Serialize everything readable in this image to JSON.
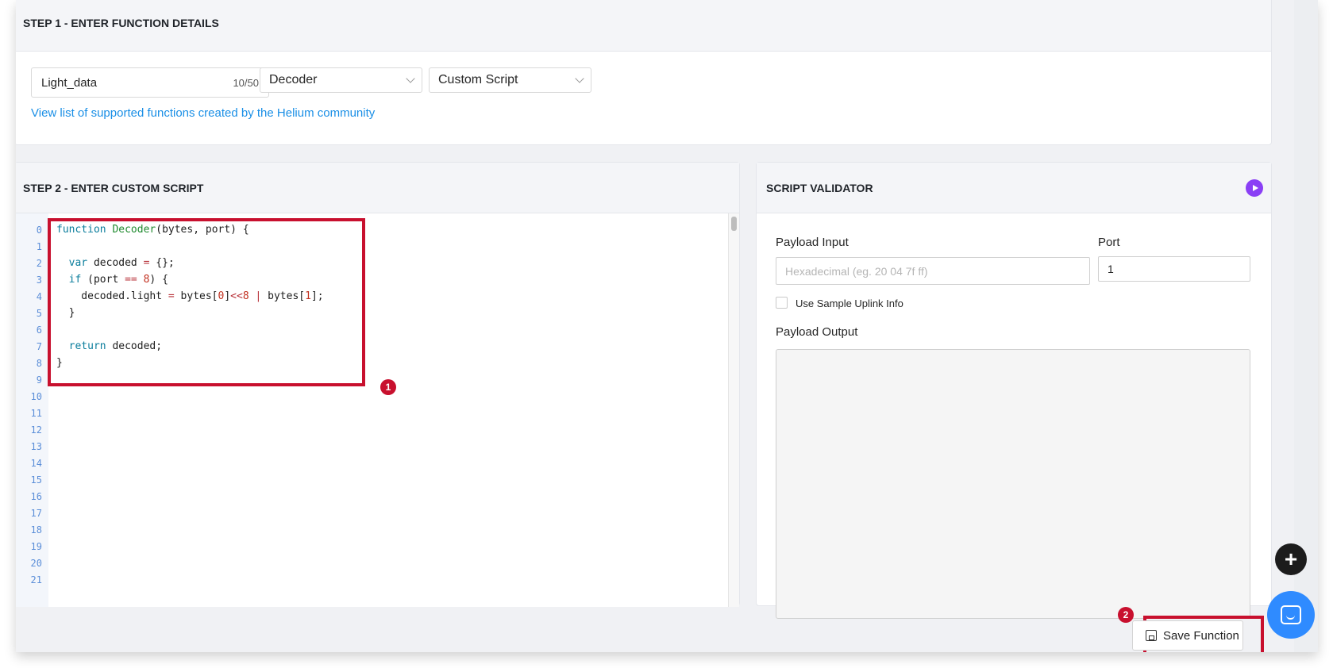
{
  "step1": {
    "title": "STEP 1 - ENTER FUNCTION DETAILS",
    "name_value": "Light_data",
    "name_count": "10/50",
    "type_select": "Decoder",
    "format_select": "Custom Script",
    "community_link": "View list of supported functions created by the Helium community"
  },
  "step2": {
    "title": "STEP 2 - ENTER CUSTOM SCRIPT",
    "line_numbers": [
      "0",
      "1",
      "2",
      "3",
      "4",
      "5",
      "6",
      "7",
      "8",
      "9",
      "10",
      "11",
      "12",
      "13",
      "14",
      "15",
      "16",
      "17",
      "18",
      "19",
      "20",
      "21"
    ]
  },
  "validator": {
    "title": "SCRIPT VALIDATOR",
    "payload_input_label": "Payload Input",
    "payload_input_placeholder": "Hexadecimal (eg. 20 04 7f ff)",
    "port_label": "Port",
    "port_value": "1",
    "sample_checkbox_label": "Use Sample Uplink Info",
    "payload_output_label": "Payload Output"
  },
  "footer": {
    "save_label": "Save Function"
  },
  "annotations": {
    "badge_1": "1",
    "badge_2": "2",
    "highlight_color": "#c8102e"
  },
  "icons": [
    "play-icon",
    "save-icon",
    "plus-icon",
    "chat-icon",
    "chevron-down-icon"
  ]
}
